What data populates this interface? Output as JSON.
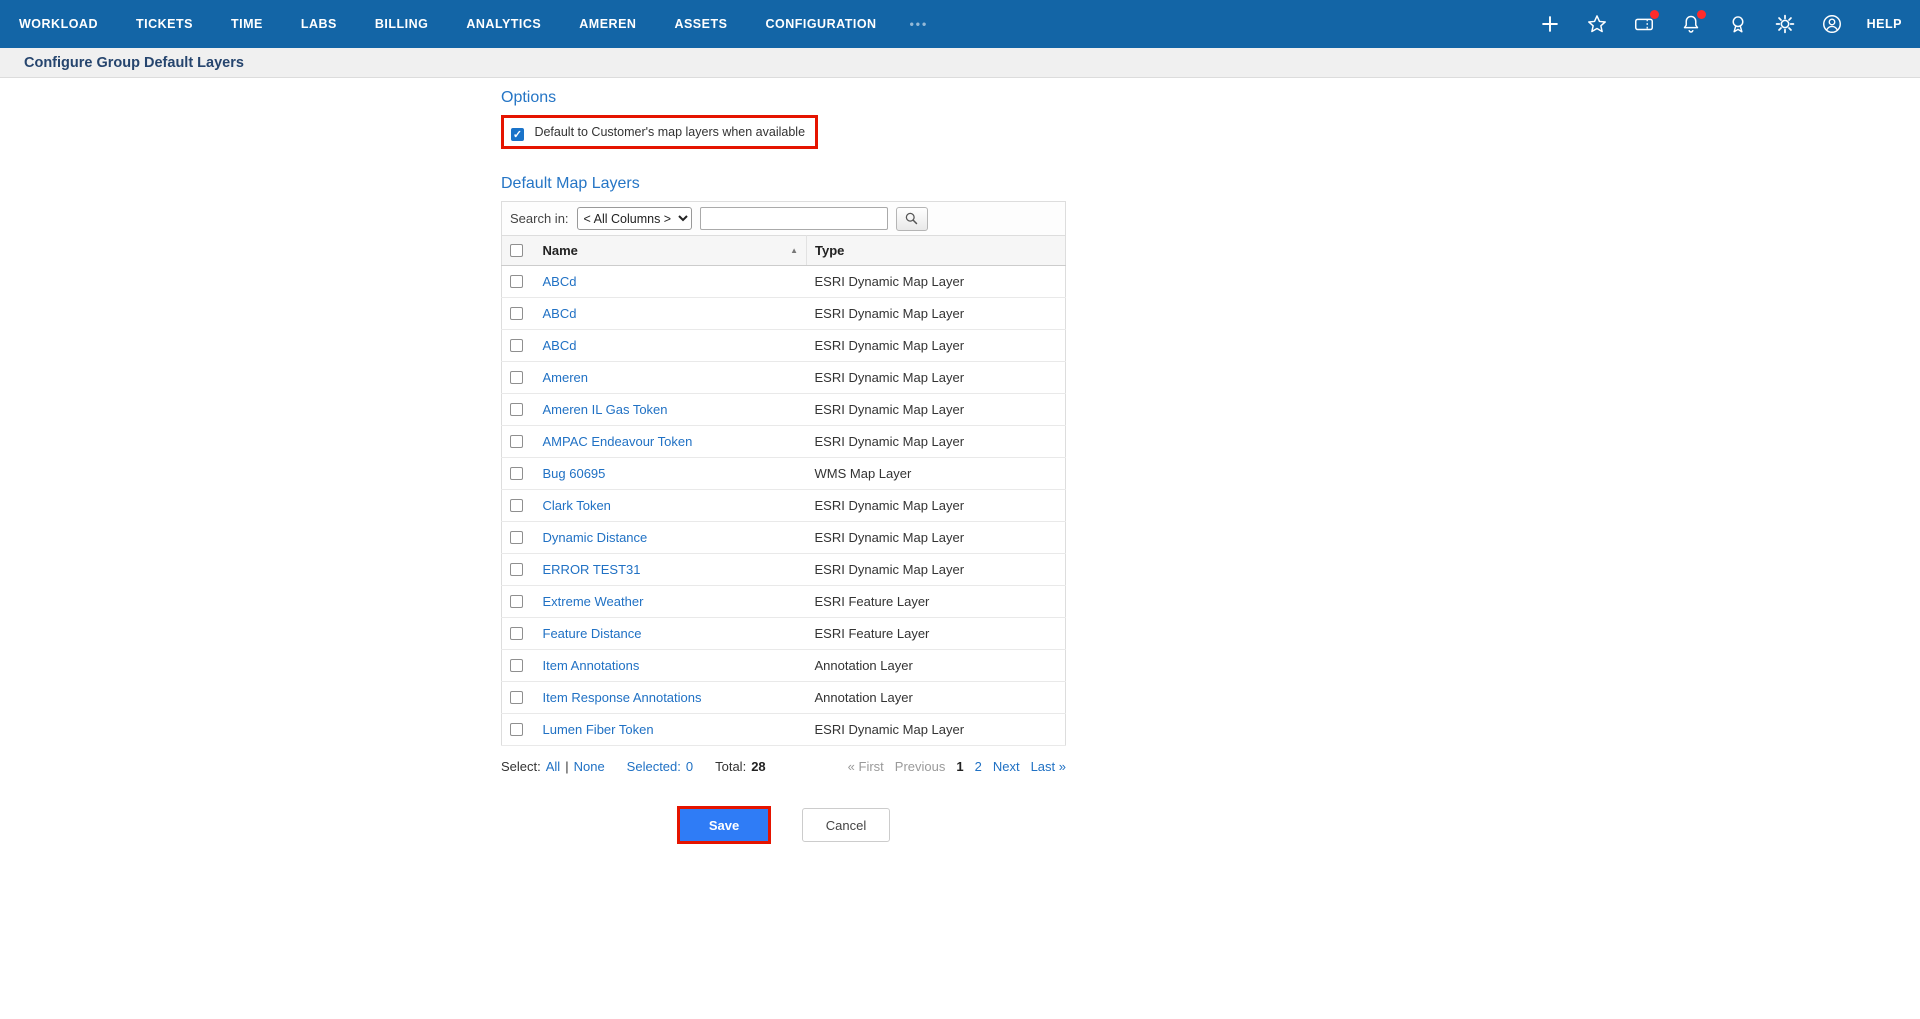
{
  "nav": {
    "items": [
      {
        "label": "WORKLOAD"
      },
      {
        "label": "TICKETS"
      },
      {
        "label": "TIME"
      },
      {
        "label": "LABS"
      },
      {
        "label": "BILLING"
      },
      {
        "label": "ANALYTICS"
      },
      {
        "label": "AMEREN"
      },
      {
        "label": "ASSETS"
      },
      {
        "label": "CONFIGURATION"
      }
    ],
    "more_label": "•••",
    "help_label": "HELP",
    "icons": [
      "plus-icon",
      "star-icon",
      "ticket-icon",
      "bell-icon",
      "badge-icon",
      "gear-icon",
      "user-icon"
    ]
  },
  "page": {
    "title": "Configure Group Default Layers"
  },
  "options": {
    "heading": "Options",
    "checkbox_label": "Default to Customer's map layers when available",
    "checkbox_checked": true,
    "checkmark": "✓"
  },
  "layers": {
    "heading": "Default Map Layers",
    "search": {
      "label": "Search in:",
      "dropdown_value": "< All Columns >",
      "input_value": ""
    },
    "table": {
      "col_name": "Name",
      "col_type": "Type",
      "sort_arrow": "▲",
      "rows": [
        {
          "name": "ABCd",
          "type": "ESRI Dynamic Map Layer"
        },
        {
          "name": "ABCd",
          "type": "ESRI Dynamic Map Layer"
        },
        {
          "name": "ABCd",
          "type": "ESRI Dynamic Map Layer"
        },
        {
          "name": "Ameren",
          "type": "ESRI Dynamic Map Layer"
        },
        {
          "name": "Ameren IL Gas Token",
          "type": "ESRI Dynamic Map Layer"
        },
        {
          "name": "AMPAC Endeavour Token",
          "type": "ESRI Dynamic Map Layer"
        },
        {
          "name": "Bug 60695",
          "type": "WMS Map Layer"
        },
        {
          "name": "Clark Token",
          "type": "ESRI Dynamic Map Layer"
        },
        {
          "name": "Dynamic Distance",
          "type": "ESRI Dynamic Map Layer"
        },
        {
          "name": "ERROR TEST31",
          "type": "ESRI Dynamic Map Layer"
        },
        {
          "name": "Extreme Weather",
          "type": "ESRI Feature Layer"
        },
        {
          "name": "Feature Distance",
          "type": "ESRI Feature Layer"
        },
        {
          "name": "Item Annotations",
          "type": "Annotation Layer"
        },
        {
          "name": "Item Response Annotations",
          "type": "Annotation Layer"
        },
        {
          "name": "Lumen Fiber Token",
          "type": "ESRI Dynamic Map Layer"
        }
      ]
    },
    "footer": {
      "select_label": "Select:",
      "all_label": "All",
      "separator": "|",
      "none_label": "None",
      "selected_label": "Selected:",
      "selected_count": "0",
      "total_label": "Total:",
      "total_count": "28"
    },
    "pagination": {
      "first": "« First",
      "previous": "Previous",
      "page1": "1",
      "page2": "2",
      "next": "Next",
      "last": "Last »"
    }
  },
  "actions": {
    "save": "Save",
    "cancel": "Cancel"
  },
  "colors": {
    "nav_background": "#1365a6",
    "heading_blue": "#2575c5",
    "link_blue": "#2071c4",
    "save_blue": "#2f7cf6",
    "annotation_red": "#e51400",
    "notification_red": "#ff2b2b"
  }
}
